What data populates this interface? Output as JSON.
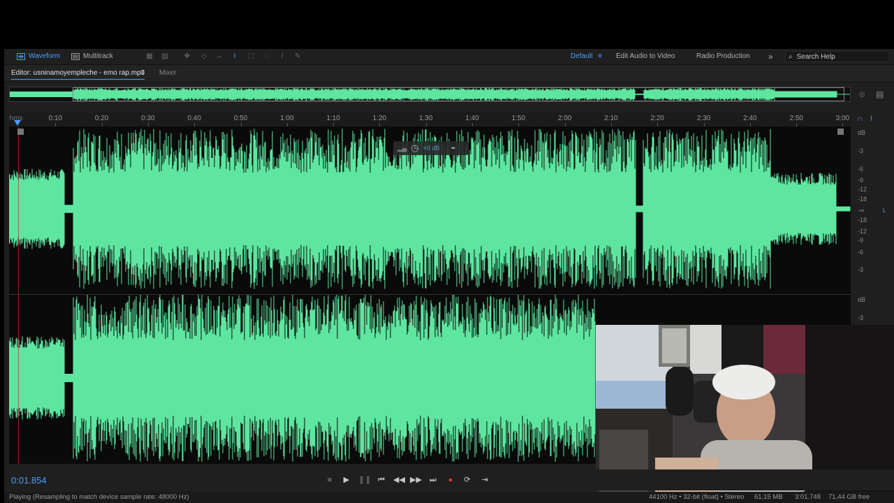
{
  "toolbar": {
    "waveform_label": "Waveform",
    "multitrack_label": "Multitrack",
    "workspaces": [
      "Default",
      "Edit Audio to Video",
      "Radio Production"
    ],
    "more_label": "»",
    "search_placeholder": "Search Help"
  },
  "editor": {
    "tab_label": "Editor: usninamoyempleche - emo rap.mp3",
    "mixer_label": "Mixer"
  },
  "ruler": {
    "unit": "hms",
    "ticks": [
      "0:10",
      "0:20",
      "0:30",
      "0:40",
      "0:50",
      "1:00",
      "1:10",
      "1:20",
      "1:30",
      "1:40",
      "1:50",
      "2:00",
      "2:10",
      "2:20",
      "2:30",
      "2:40",
      "2:50",
      "3:00"
    ]
  },
  "hud": {
    "gain": "+0 dB"
  },
  "db_scale": {
    "top": [
      "dB",
      "-3",
      "-6",
      "-9",
      "-12",
      "-18",
      "-∞",
      "-18",
      "-12",
      "-9",
      "-6",
      "-3"
    ],
    "bottom": [
      "dB",
      "-3"
    ],
    "channel_label": "L"
  },
  "transport": {
    "timecode": "0:01.854"
  },
  "status": {
    "left": "Playing (Resampling to match device sample rate: 48000 Hz)",
    "sample_info": "44100 Hz • 32-bit (float) • Stereo",
    "file_size": "61,15 MB",
    "duration": "3:01.748",
    "free_space": "71,44 GB free"
  },
  "colors": {
    "waveform": "#5ee6a0",
    "accent": "#4a9eff",
    "record": "#e03030"
  }
}
